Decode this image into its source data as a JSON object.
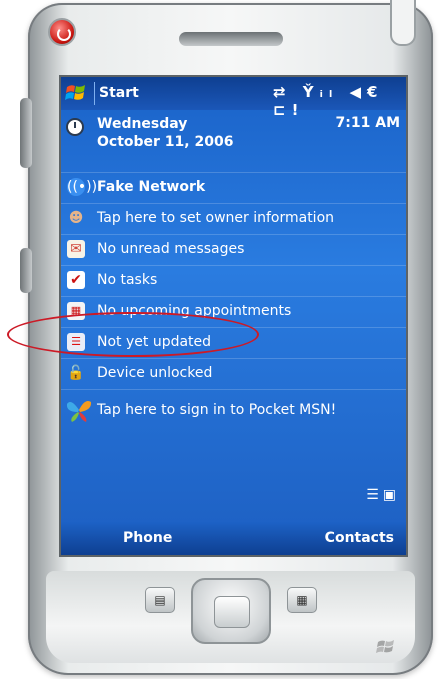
{
  "title_bar": {
    "start_label": "Start",
    "status_icons": "⇄ Y̌ᵢₗ ◀€ ⊏!"
  },
  "today": {
    "date": {
      "day": "Wednesday",
      "full_date": "October 11, 2006",
      "time": "7:11 AM"
    },
    "items": [
      {
        "label": "Fake Network",
        "bold": true,
        "icon": "network-icon"
      },
      {
        "label": "Tap here to set owner information",
        "bold": false,
        "icon": "owner-icon"
      },
      {
        "label": "No unread messages",
        "bold": false,
        "icon": "messages-icon"
      },
      {
        "label": "No tasks",
        "bold": false,
        "icon": "tasks-icon"
      },
      {
        "label": "No upcoming appointments",
        "bold": false,
        "icon": "calendar-icon"
      },
      {
        "label": "Not yet updated",
        "bold": false,
        "icon": "sync-error-icon"
      },
      {
        "label": "Device unlocked",
        "bold": false,
        "icon": "lock-icon"
      },
      {
        "label": "Tap here to sign in to Pocket MSN!",
        "bold": false,
        "icon": "msn-butterfly-icon"
      }
    ]
  },
  "softkeys": {
    "left": "Phone",
    "right": "Contacts"
  },
  "colors": {
    "screen_blue": "#2a7ce0",
    "highlight_red": "#cc1a26"
  }
}
